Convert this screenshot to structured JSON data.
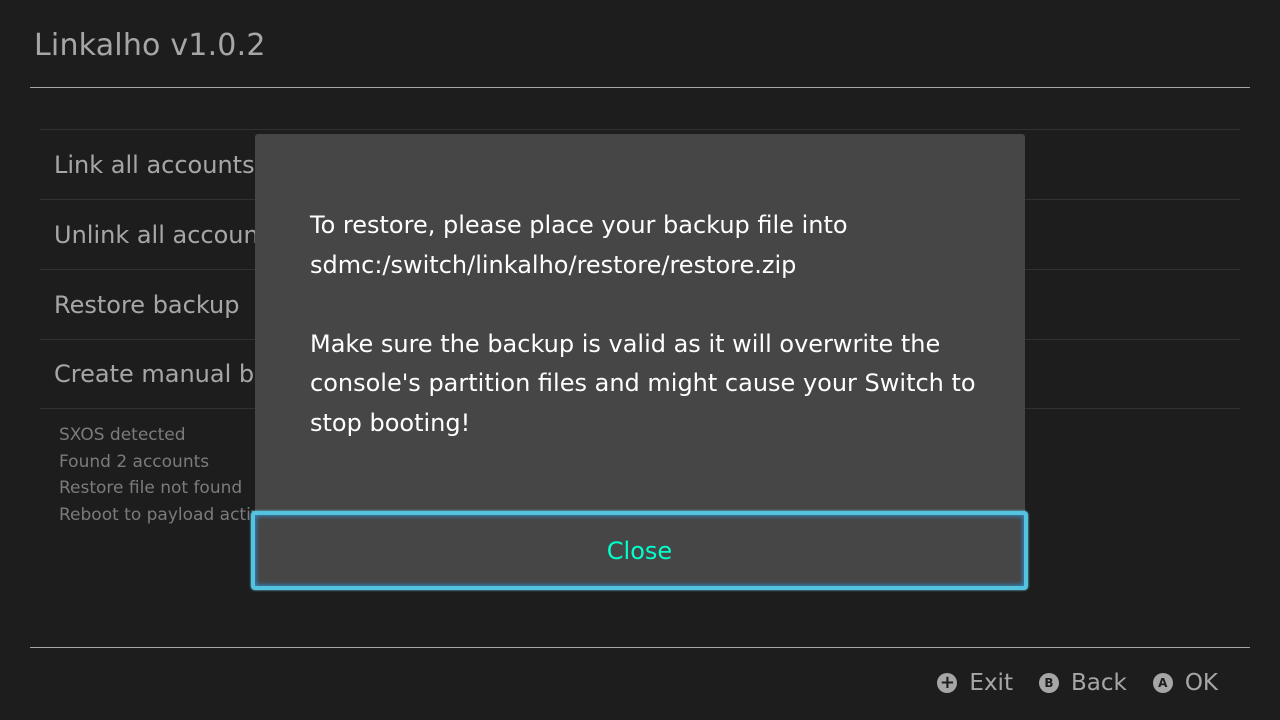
{
  "header": {
    "title": "Linkalho v1.0.2"
  },
  "menu": {
    "items": [
      {
        "label": "Link all accounts"
      },
      {
        "label": "Unlink all accounts"
      },
      {
        "label": "Restore backup"
      },
      {
        "label": "Create manual backup"
      }
    ]
  },
  "status": {
    "lines": [
      "SXOS detected",
      "Found 2 accounts",
      "Restore file not found",
      "Reboot to payload active"
    ]
  },
  "footer": {
    "hints": [
      {
        "button": "+",
        "icon": "plus-button-icon",
        "label": "Exit"
      },
      {
        "button": "B",
        "icon": "b-button-icon",
        "label": "Back"
      },
      {
        "button": "A",
        "icon": "a-button-icon",
        "label": "OK"
      }
    ]
  },
  "dialog": {
    "paragraph1_line1": "To restore, please place your backup file into",
    "paragraph1_line2": "sdmc:/switch/linkalho/restore/restore.zip",
    "paragraph2_line1": "Make sure the backup is valid as it will overwrite the",
    "paragraph2_line2": "console's partition files and might cause your Switch to",
    "paragraph2_line3": "stop booting!",
    "close_label": "Close"
  },
  "colors": {
    "background": "#2d2d2d",
    "dialog": "#464646",
    "accent_border": "#54c3e0",
    "accent_text": "#00ffca"
  }
}
